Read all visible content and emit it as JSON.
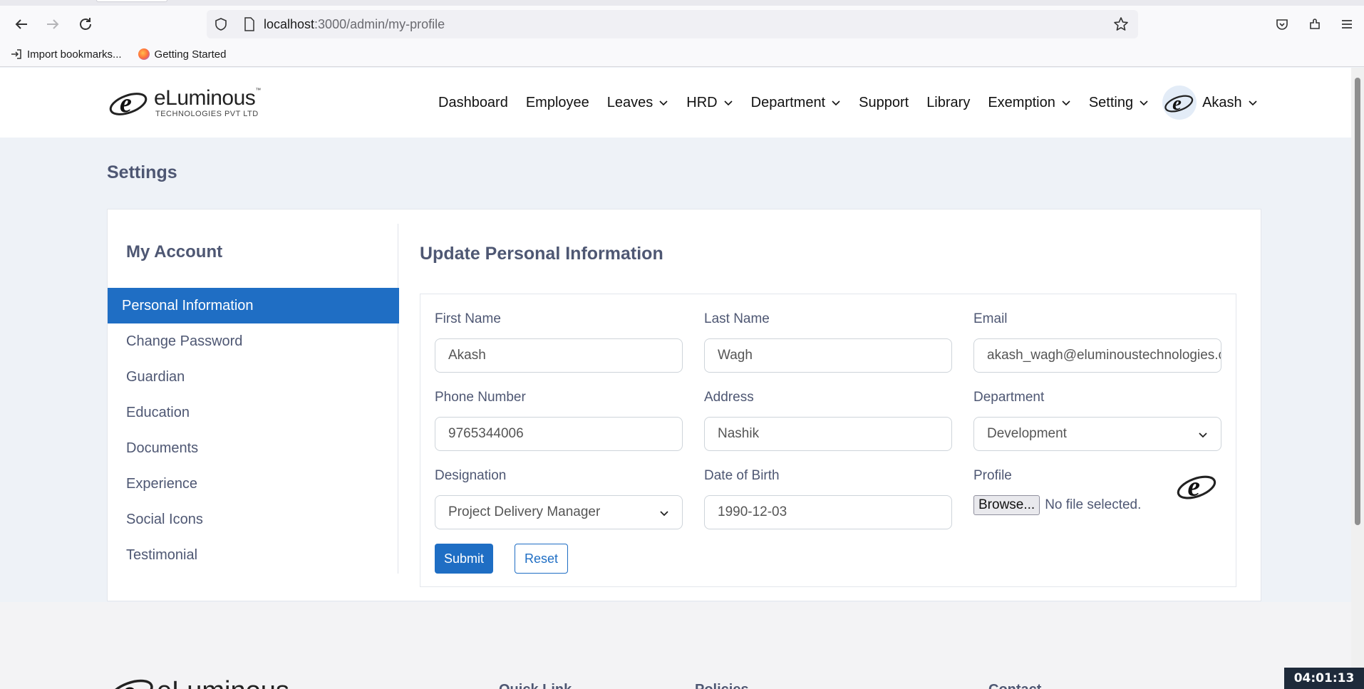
{
  "browser": {
    "url_host": "localhost",
    "url_path": ":3000/admin/my-profile",
    "bookmarks": [
      {
        "label": "Import bookmarks...",
        "icon": "import-icon"
      },
      {
        "label": "Getting Started",
        "icon": "firefox-icon"
      }
    ]
  },
  "header": {
    "logo_text": "eLuminous",
    "logo_tm": "™",
    "logo_sub": "TECHNOLOGIES PVT LTD",
    "nav": [
      {
        "label": "Dashboard",
        "dropdown": false
      },
      {
        "label": "Employee",
        "dropdown": false
      },
      {
        "label": "Leaves",
        "dropdown": true
      },
      {
        "label": "HRD",
        "dropdown": true
      },
      {
        "label": "Department",
        "dropdown": true
      },
      {
        "label": "Support",
        "dropdown": false
      },
      {
        "label": "Library",
        "dropdown": false
      },
      {
        "label": "Exemption",
        "dropdown": true
      },
      {
        "label": "Setting",
        "dropdown": true
      }
    ],
    "user_name": "Akash"
  },
  "page": {
    "title": "Settings"
  },
  "sidebar": {
    "title": "My Account",
    "items": [
      {
        "label": "Personal Information",
        "active": true
      },
      {
        "label": "Change Password",
        "active": false
      },
      {
        "label": "Guardian",
        "active": false
      },
      {
        "label": "Education",
        "active": false
      },
      {
        "label": "Documents",
        "active": false
      },
      {
        "label": "Experience",
        "active": false
      },
      {
        "label": "Social Icons",
        "active": false
      },
      {
        "label": "Testimonial",
        "active": false
      }
    ]
  },
  "form": {
    "title": "Update Personal Information",
    "first_name": {
      "label": "First Name",
      "value": "Akash"
    },
    "last_name": {
      "label": "Last Name",
      "value": "Wagh"
    },
    "email": {
      "label": "Email",
      "value": "akash_wagh@eluminoustechnologies.com"
    },
    "phone": {
      "label": "Phone Number",
      "value": "9765344006"
    },
    "address": {
      "label": "Address",
      "value": "Nashik"
    },
    "department": {
      "label": "Department",
      "value": "Development"
    },
    "designation": {
      "label": "Designation",
      "value": "Project Delivery Manager"
    },
    "dob": {
      "label": "Date of Birth",
      "value": "1990-12-03"
    },
    "profile": {
      "label": "Profile",
      "browse_label": "Browse...",
      "file_status": "No file selected."
    },
    "submit_label": "Submit",
    "reset_label": "Reset"
  },
  "footer": {
    "logo_text": "eLuminous",
    "columns": [
      "Quick Link",
      "Policies",
      "Contact"
    ]
  },
  "clock": "04:01:13",
  "colors": {
    "accent": "#1f6ec4",
    "heading": "#4e5773",
    "page_bg": "#eef2f7"
  }
}
